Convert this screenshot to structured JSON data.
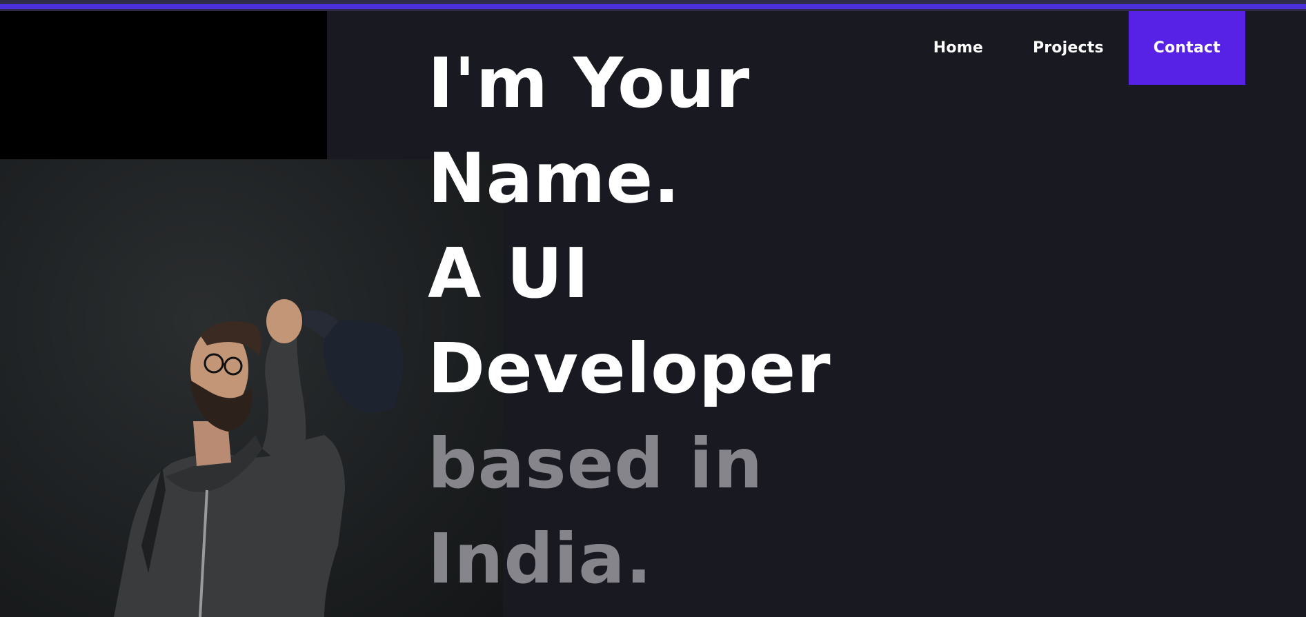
{
  "nav": {
    "home_label": "Home",
    "projects_label": "Projects",
    "contact_label": "Contact"
  },
  "hero": {
    "line1": "I'm Your",
    "line2": "Name.",
    "line3": "A UI",
    "line4": "Developer",
    "line5": "based in",
    "line6": "India."
  },
  "colors": {
    "accent": "#5721e6",
    "background": "#191921",
    "heading_primary": "#ffffff",
    "heading_secondary": "#86858b"
  },
  "photo": {
    "subject": "man with beard and glasses in grey hoodie holding a cap"
  }
}
